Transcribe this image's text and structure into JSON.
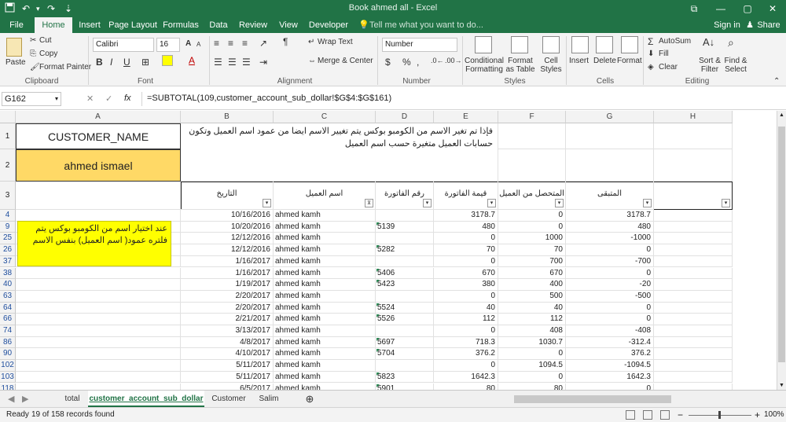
{
  "window": {
    "title": "Book ahmed all - Excel",
    "minimize": "—",
    "maximize": "▢",
    "close": "✕",
    "restore": "⧉"
  },
  "qat": {
    "undo": "↶",
    "redo": "↷",
    "customize": "⇣"
  },
  "tabs": [
    "File",
    "Home",
    "Insert",
    "Page Layout",
    "Formulas",
    "Data",
    "Review",
    "View",
    "Developer"
  ],
  "tell_me": "Tell me what you want to do...",
  "sign_in": "Sign in",
  "share": "Share",
  "ribbon": {
    "clipboard": {
      "label": "Clipboard",
      "paste": "Paste",
      "cut": "Cut",
      "copy": "Copy",
      "format_painter": "Format Painter"
    },
    "font": {
      "label": "Font",
      "name": "Calibri",
      "size": "16",
      "bold": "B",
      "italic": "I",
      "underline": "U",
      "grow": "A",
      "shrink": "A"
    },
    "alignment": {
      "label": "Alignment",
      "wrap": "Wrap Text",
      "merge": "Merge & Center"
    },
    "number": {
      "label": "Number",
      "format": "Number",
      "currency": "$",
      "percent": "%",
      "comma": ","
    },
    "styles": {
      "label": "Styles",
      "conditional": "Conditional Formatting",
      "format_table": "Format as Table",
      "cell_styles": "Cell Styles"
    },
    "cells": {
      "label": "Cells",
      "insert": "Insert",
      "delete": "Delete",
      "format": "Format"
    },
    "editing": {
      "label": "Editing",
      "autosum": "AutoSum",
      "fill": "Fill",
      "clear": "Clear",
      "sort": "Sort & Filter",
      "find": "Find & Select"
    }
  },
  "formula_bar": {
    "name_box": "G162",
    "fx": "fx",
    "formula": "=SUBTOTAL(109,customer_account_sub_dollar!$G$4:$G$161)"
  },
  "columns": [
    "A",
    "B",
    "C",
    "D",
    "E",
    "F",
    "G",
    "H"
  ],
  "header_cells": {
    "customer_name_label": "CUSTOMER_NAME",
    "customer_name_value": "ahmed ismael",
    "note": "فإذا تم تغير الاسم من الكومبو بوكس يتم تغيير الاسم ايضا من عمود اسم العميل وتكون حسابات العميل متغيرة حسب اسم العميل",
    "side_note": "عند اختيار اسم من الكومبو بوكس يتم فلتره عمود( اسم العميل) بنفس الاسم"
  },
  "table_headers": [
    "التاريخ",
    "اسم العميل",
    "رقم الفاتورة",
    "قيمة الفاتورة",
    "المتحصل من العميل",
    "المتبقى"
  ],
  "rows": [
    {
      "row": "4",
      "date": "10/16/2016",
      "customer": "ahmed kamh",
      "invoice_no": "",
      "invoice_val": "3178.7",
      "paid": "0",
      "remaining": "3178.7"
    },
    {
      "row": "9",
      "date": "10/20/2016",
      "customer": "ahmed kamh",
      "invoice_no": "5139",
      "invoice_val": "480",
      "paid": "0",
      "remaining": "480"
    },
    {
      "row": "25",
      "date": "12/12/2016",
      "customer": "ahmed kamh",
      "invoice_no": "",
      "invoice_val": "0",
      "paid": "1000",
      "remaining": "-1000"
    },
    {
      "row": "26",
      "date": "12/12/2016",
      "customer": "ahmed kamh",
      "invoice_no": "5282",
      "invoice_val": "70",
      "paid": "70",
      "remaining": "0"
    },
    {
      "row": "37",
      "date": "1/16/2017",
      "customer": "ahmed kamh",
      "invoice_no": "",
      "invoice_val": "0",
      "paid": "700",
      "remaining": "-700"
    },
    {
      "row": "38",
      "date": "1/16/2017",
      "customer": "ahmed kamh",
      "invoice_no": "5406",
      "invoice_val": "670",
      "paid": "670",
      "remaining": "0"
    },
    {
      "row": "40",
      "date": "1/19/2017",
      "customer": "ahmed kamh",
      "invoice_no": "5423",
      "invoice_val": "380",
      "paid": "400",
      "remaining": "-20"
    },
    {
      "row": "63",
      "date": "2/20/2017",
      "customer": "ahmed kamh",
      "invoice_no": "",
      "invoice_val": "0",
      "paid": "500",
      "remaining": "-500"
    },
    {
      "row": "64",
      "date": "2/20/2017",
      "customer": "ahmed kamh",
      "invoice_no": "5524",
      "invoice_val": "40",
      "paid": "40",
      "remaining": "0"
    },
    {
      "row": "66",
      "date": "2/21/2017",
      "customer": "ahmed kamh",
      "invoice_no": "5526",
      "invoice_val": "112",
      "paid": "112",
      "remaining": "0"
    },
    {
      "row": "74",
      "date": "3/13/2017",
      "customer": "ahmed kamh",
      "invoice_no": "",
      "invoice_val": "0",
      "paid": "408",
      "remaining": "-408"
    },
    {
      "row": "86",
      "date": "4/8/2017",
      "customer": "ahmed kamh",
      "invoice_no": "5697",
      "invoice_val": "718.3",
      "paid": "1030.7",
      "remaining": "-312.4"
    },
    {
      "row": "90",
      "date": "4/10/2017",
      "customer": "ahmed kamh",
      "invoice_no": "5704",
      "invoice_val": "376.2",
      "paid": "0",
      "remaining": "376.2"
    },
    {
      "row": "102",
      "date": "5/11/2017",
      "customer": "ahmed kamh",
      "invoice_no": "",
      "invoice_val": "0",
      "paid": "1094.5",
      "remaining": "-1094.5"
    },
    {
      "row": "103",
      "date": "5/11/2017",
      "customer": "ahmed kamh",
      "invoice_no": "5823",
      "invoice_val": "1642.3",
      "paid": "0",
      "remaining": "1642.3"
    },
    {
      "row": "118",
      "date": "6/5/2017",
      "customer": "ahmed kamh",
      "invoice_no": "5901",
      "invoice_val": "80",
      "paid": "80",
      "remaining": "0"
    }
  ],
  "row_labels_top": [
    "1",
    "2",
    "3"
  ],
  "sheets": [
    "total",
    "customer_account_sub_dollar",
    "Customer",
    "Salim"
  ],
  "add_sheet": "⊕",
  "status": {
    "ready": "Ready",
    "records": "19 of 158 records found",
    "zoom": "100%",
    "zoom_minus": "−",
    "zoom_plus": "+"
  },
  "colors": {
    "excel_green": "#217346",
    "yellow": "#FFD966",
    "bright_yellow": "#FFFF00",
    "link_blue": "#1F4E9E"
  }
}
